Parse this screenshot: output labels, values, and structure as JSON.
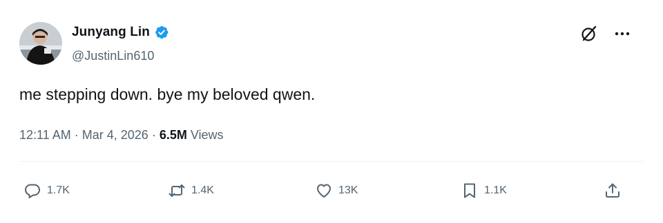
{
  "author": {
    "display_name": "Junyang Lin",
    "handle": "@JustinLin610",
    "verified": true
  },
  "tweet": {
    "text": "me stepping down. bye my beloved qwen.",
    "time": "12:11 AM",
    "date": "Mar 4, 2026",
    "views_count": "6.5M",
    "views_label": "Views"
  },
  "actions": {
    "replies": "1.7K",
    "reposts": "1.4K",
    "likes": "13K",
    "bookmarks": "1.1K"
  },
  "icons": {
    "top_right": [
      "grok-icon",
      "more-icon"
    ],
    "action_bar": [
      "reply-icon",
      "repost-icon",
      "like-icon",
      "bookmark-icon",
      "share-icon"
    ]
  },
  "colors": {
    "text_primary": "#0f1419",
    "text_secondary": "#536471",
    "verified_blue": "#1d9bf0",
    "divider": "#eff3f4"
  }
}
